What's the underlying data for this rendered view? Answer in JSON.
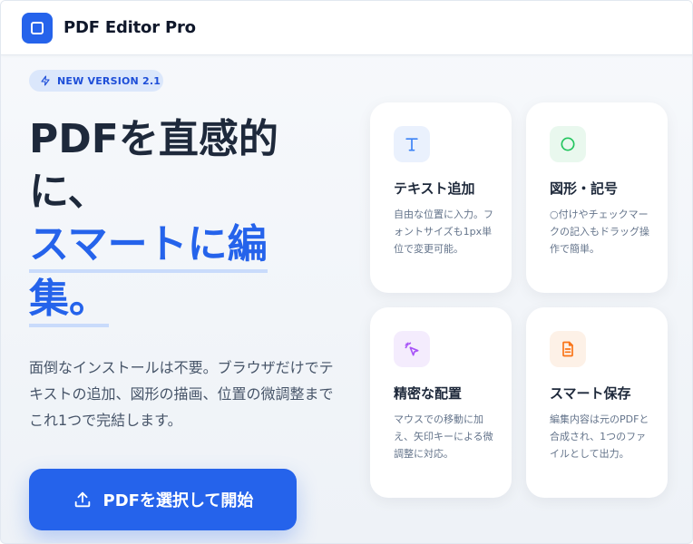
{
  "app": {
    "title": "PDF Editor Pro",
    "logo_icon": "square-icon",
    "brand_color": "#2563eb"
  },
  "badge": {
    "label": "NEW VERSION 2.1",
    "icon": "bolt-icon"
  },
  "hero": {
    "title_line1": "PDFを直感的",
    "title_line2": "に、",
    "title_accent_line1": "スマートに編",
    "title_accent_line2": "集。",
    "description": "面倒なインストールは不要。ブラウザだけでテキストの追加、図形の描画、位置の微調整までこれ1つで完結します。"
  },
  "cta": {
    "label": "PDFを選択して開始",
    "icon": "upload-icon"
  },
  "features": [
    {
      "title": "テキスト追加",
      "description": "自由な位置に入力。フォントサイズも1px単位で変更可能。",
      "icon": "text-icon",
      "icon_color": "#3b82f6",
      "icon_bg": "#eaf1fd"
    },
    {
      "title": "図形・記号",
      "description": "○付けやチェックマークの記入もドラッグ操作で簡単。",
      "icon": "circle-icon",
      "icon_color": "#22c55e",
      "icon_bg": "#e9f8ee"
    },
    {
      "title": "精密な配置",
      "description": "マウスでの移動に加え、矢印キーによる微調整に対応。",
      "icon": "cursor-click-icon",
      "icon_color": "#a855f7",
      "icon_bg": "#f4ecfd"
    },
    {
      "title": "スマート保存",
      "description": "編集内容は元のPDFと合成され、1つのファイルとして出力。",
      "icon": "file-icon",
      "icon_color": "#f97316",
      "icon_bg": "#fdf1e7"
    }
  ]
}
